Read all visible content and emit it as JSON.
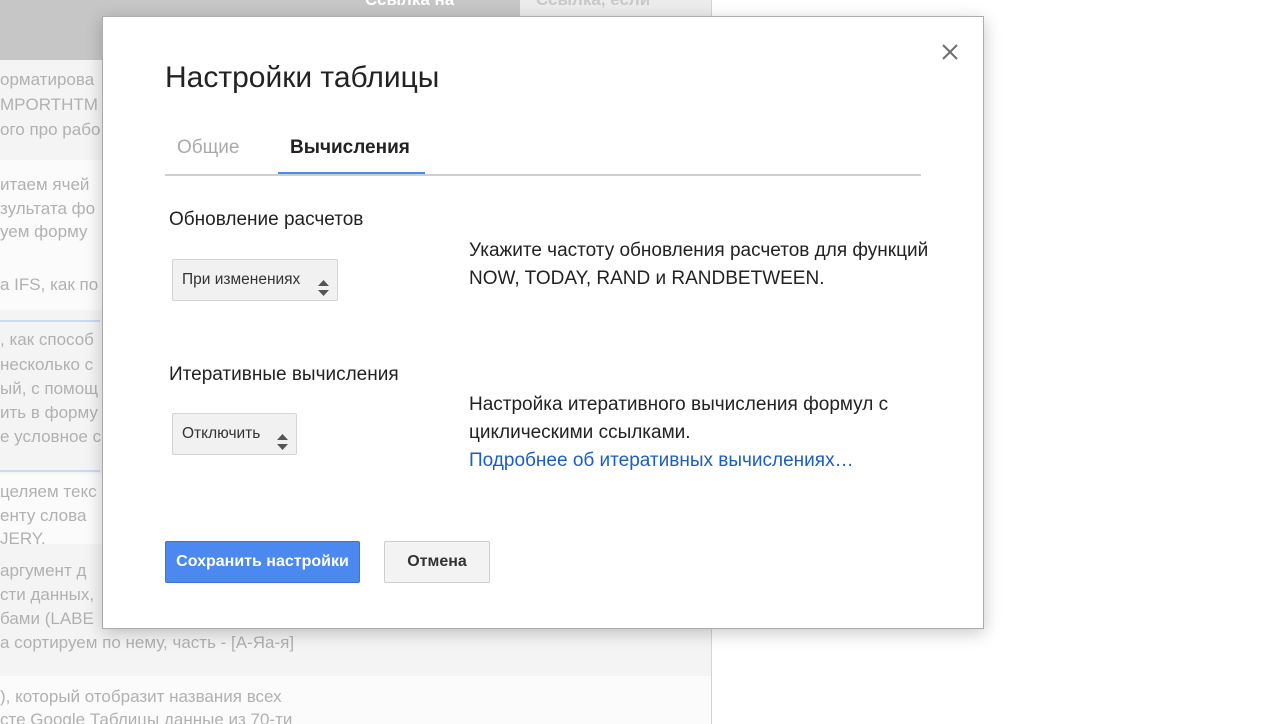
{
  "background": {
    "header_col1": "Ссылка на",
    "header_col2": "Ссылка, если",
    "lines": [
      "орматирова",
      "MPORTHTM",
      "ого про рабо",
      "итаем ячей",
      "зультата фо",
      "уем форму",
      "а IFS, как по",
      ", как способ",
      "несколько с",
      "ый, с помощ",
      "ить в форму",
      "е условное с",
      "целяем текс",
      "енту слова",
      "JERY.",
      "аргумент д",
      "сти данных,",
      "бами (LABE",
      "а сортируем по нему, часть - [А-Яа-я]",
      "), который отобразит названия всех",
      "сте Google Таблицы данные из 70-ти"
    ]
  },
  "dialog": {
    "title": "Настройки таблицы",
    "close_icon": "close-icon",
    "tabs": [
      {
        "label": "Общие",
        "active": false
      },
      {
        "label": "Вычисления",
        "active": true
      }
    ],
    "recalc": {
      "label": "Обновление расчетов",
      "selected": "При изменениях",
      "description": "Укажите частоту обновления расчетов для функций NOW, TODAY, RAND и RANDBETWEEN."
    },
    "iterative": {
      "label": "Итеративные вычисления",
      "selected": "Отключить",
      "description": "Настройка итеративного вычисления формул с циклическими ссылками.",
      "link": "Подробнее об итеративных вычислениях…"
    },
    "buttons": {
      "save": "Сохранить настройки",
      "cancel": "Отмена"
    }
  },
  "colors": {
    "accent": "#4b89f0",
    "tab_underline": "#4a8de8",
    "link": "#1a5dc6"
  }
}
